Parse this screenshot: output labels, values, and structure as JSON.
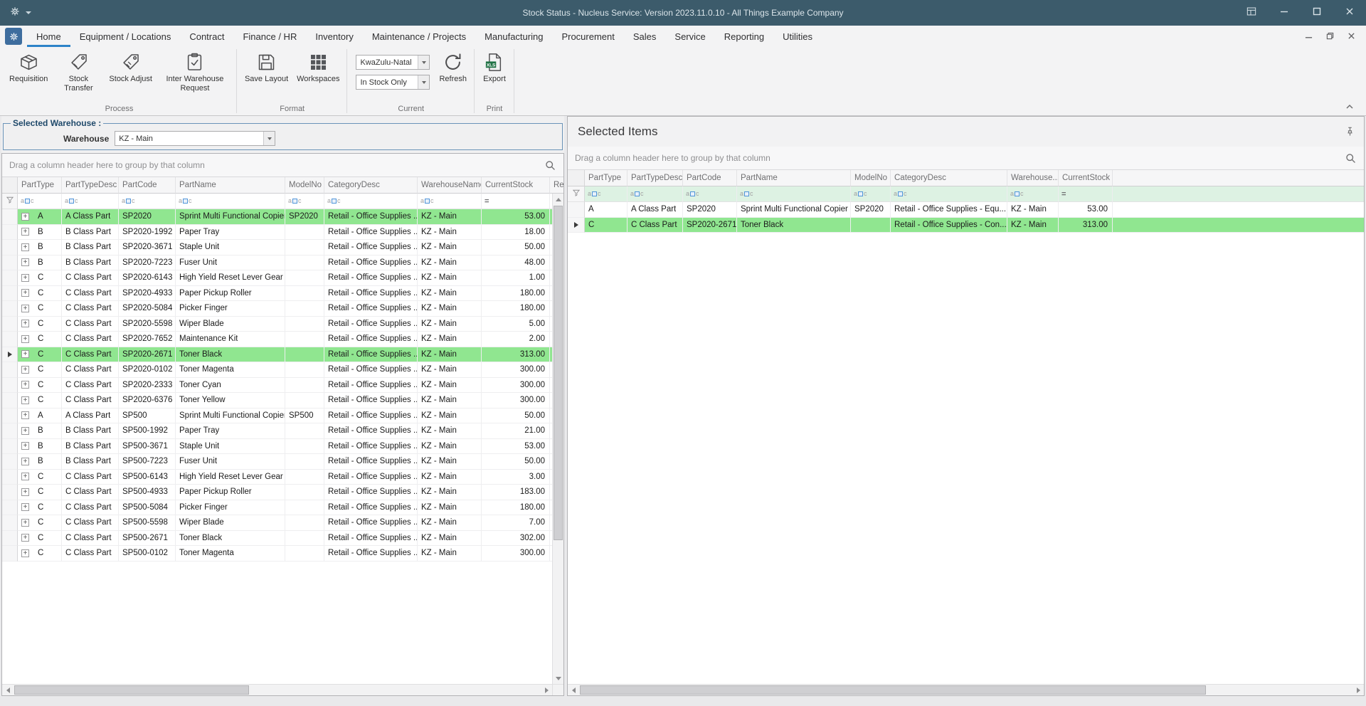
{
  "titlebar": {
    "title": "Stock Status - Nucleus Service: Version 2023.11.0.10 - All Things Example Company"
  },
  "ribbon": {
    "active_tab": "Home",
    "tabs": [
      "Home",
      "Equipment / Locations",
      "Contract",
      "Finance / HR",
      "Inventory",
      "Maintenance / Projects",
      "Manufacturing",
      "Procurement",
      "Sales",
      "Service",
      "Reporting",
      "Utilities"
    ],
    "groups": [
      {
        "label": "Process",
        "items": [
          {
            "type": "button",
            "label": "Requisition",
            "icon": "requisition-icon"
          },
          {
            "type": "button",
            "label": "Stock Transfer",
            "icon": "stock-transfer-icon"
          },
          {
            "type": "button",
            "label": "Stock Adjust",
            "icon": "stock-adjust-icon"
          },
          {
            "type": "button",
            "label": "Inter Warehouse Request",
            "icon": "inter-warehouse-request-icon"
          }
        ]
      },
      {
        "label": "Format",
        "items": [
          {
            "type": "button",
            "label": "Save Layout",
            "icon": "save-layout-icon"
          },
          {
            "type": "button",
            "label": "Workspaces",
            "icon": "workspaces-icon"
          }
        ]
      },
      {
        "label": "Current",
        "items": [
          {
            "type": "stack",
            "dropdowns": [
              {
                "name": "region-dropdown",
                "value": "KwaZulu-Natal"
              },
              {
                "name": "stock-filter-dropdown",
                "value": "In Stock Only"
              }
            ]
          },
          {
            "type": "button",
            "label": "Refresh",
            "icon": "refresh-icon"
          }
        ]
      },
      {
        "label": "Print",
        "items": [
          {
            "type": "button",
            "label": "Export",
            "icon": "export-xls-icon"
          }
        ]
      }
    ]
  },
  "selected_warehouse": {
    "legend": "Selected Warehouse :",
    "label": "Warehouse",
    "value": "KZ - Main"
  },
  "left_grid": {
    "group_panel_text": "Drag a column header here to group by that column",
    "columns": [
      "PartType",
      "PartTypeDesc",
      "PartCode",
      "PartName",
      "ModelNo",
      "CategoryDesc",
      "WarehouseName",
      "CurrentStock",
      "Res"
    ],
    "rows": [
      {
        "cells": [
          "A",
          "A Class Part",
          "SP2020",
          "Sprint Multi Functional Copier",
          "SP2020",
          "Retail - Office Supplies ...",
          "KZ - Main",
          "53.00"
        ],
        "highlight": true,
        "focused": false
      },
      {
        "cells": [
          "B",
          "B Class Part",
          "SP2020-1992",
          "Paper Tray",
          "",
          "Retail - Office Supplies ...",
          "KZ - Main",
          "18.00"
        ],
        "highlight": false,
        "focused": false
      },
      {
        "cells": [
          "B",
          "B Class Part",
          "SP2020-3671",
          "Staple Unit",
          "",
          "Retail - Office Supplies ...",
          "KZ - Main",
          "50.00"
        ],
        "highlight": false,
        "focused": false
      },
      {
        "cells": [
          "B",
          "B Class Part",
          "SP2020-7223",
          "Fuser Unit",
          "",
          "Retail - Office Supplies ...",
          "KZ - Main",
          "48.00"
        ],
        "highlight": false,
        "focused": false
      },
      {
        "cells": [
          "C",
          "C Class Part",
          "SP2020-6143",
          "High Yield Reset Lever Gear",
          "",
          "Retail - Office Supplies ...",
          "KZ - Main",
          "1.00"
        ],
        "highlight": false,
        "focused": false
      },
      {
        "cells": [
          "C",
          "C Class Part",
          "SP2020-4933",
          "Paper Pickup Roller",
          "",
          "Retail - Office Supplies ...",
          "KZ - Main",
          "180.00"
        ],
        "highlight": false,
        "focused": false
      },
      {
        "cells": [
          "C",
          "C Class Part",
          "SP2020-5084",
          "Picker Finger",
          "",
          "Retail - Office Supplies ...",
          "KZ - Main",
          "180.00"
        ],
        "highlight": false,
        "focused": false
      },
      {
        "cells": [
          "C",
          "C Class Part",
          "SP2020-5598",
          "Wiper Blade",
          "",
          "Retail - Office Supplies ...",
          "KZ - Main",
          "5.00"
        ],
        "highlight": false,
        "focused": false
      },
      {
        "cells": [
          "C",
          "C Class Part",
          "SP2020-7652",
          "Maintenance Kit",
          "",
          "Retail - Office Supplies ...",
          "KZ - Main",
          "2.00"
        ],
        "highlight": false,
        "focused": false
      },
      {
        "cells": [
          "C",
          "C Class Part",
          "SP2020-2671",
          "Toner Black",
          "",
          "Retail - Office Supplies ...",
          "KZ - Main",
          "313.00"
        ],
        "highlight": true,
        "focused": true
      },
      {
        "cells": [
          "C",
          "C Class Part",
          "SP2020-0102",
          "Toner Magenta",
          "",
          "Retail - Office Supplies ...",
          "KZ - Main",
          "300.00"
        ],
        "highlight": false,
        "focused": false
      },
      {
        "cells": [
          "C",
          "C Class Part",
          "SP2020-2333",
          "Toner Cyan",
          "",
          "Retail - Office Supplies ...",
          "KZ - Main",
          "300.00"
        ],
        "highlight": false,
        "focused": false
      },
      {
        "cells": [
          "C",
          "C Class Part",
          "SP2020-6376",
          "Toner Yellow",
          "",
          "Retail - Office Supplies ...",
          "KZ - Main",
          "300.00"
        ],
        "highlight": false,
        "focused": false
      },
      {
        "cells": [
          "A",
          "A Class Part",
          "SP500",
          "Sprint Multi Functional Copier",
          "SP500",
          "Retail - Office Supplies ...",
          "KZ - Main",
          "50.00"
        ],
        "highlight": false,
        "focused": false
      },
      {
        "cells": [
          "B",
          "B Class Part",
          "SP500-1992",
          "Paper Tray",
          "",
          "Retail - Office Supplies ...",
          "KZ - Main",
          "21.00"
        ],
        "highlight": false,
        "focused": false
      },
      {
        "cells": [
          "B",
          "B Class Part",
          "SP500-3671",
          "Staple Unit",
          "",
          "Retail - Office Supplies ...",
          "KZ - Main",
          "53.00"
        ],
        "highlight": false,
        "focused": false
      },
      {
        "cells": [
          "B",
          "B Class Part",
          "SP500-7223",
          "Fuser Unit",
          "",
          "Retail - Office Supplies ...",
          "KZ - Main",
          "50.00"
        ],
        "highlight": false,
        "focused": false
      },
      {
        "cells": [
          "C",
          "C Class Part",
          "SP500-6143",
          "High Yield Reset Lever Gear",
          "",
          "Retail - Office Supplies ...",
          "KZ - Main",
          "3.00"
        ],
        "highlight": false,
        "focused": false
      },
      {
        "cells": [
          "C",
          "C Class Part",
          "SP500-4933",
          "Paper Pickup Roller",
          "",
          "Retail - Office Supplies ...",
          "KZ - Main",
          "183.00"
        ],
        "highlight": false,
        "focused": false
      },
      {
        "cells": [
          "C",
          "C Class Part",
          "SP500-5084",
          "Picker Finger",
          "",
          "Retail - Office Supplies ...",
          "KZ - Main",
          "180.00"
        ],
        "highlight": false,
        "focused": false
      },
      {
        "cells": [
          "C",
          "C Class Part",
          "SP500-5598",
          "Wiper Blade",
          "",
          "Retail - Office Supplies ...",
          "KZ - Main",
          "7.00"
        ],
        "highlight": false,
        "focused": false
      },
      {
        "cells": [
          "C",
          "C Class Part",
          "SP500-2671",
          "Toner Black",
          "",
          "Retail - Office Supplies ...",
          "KZ - Main",
          "302.00"
        ],
        "highlight": false,
        "focused": false
      },
      {
        "cells": [
          "C",
          "C Class Part",
          "SP500-0102",
          "Toner Magenta",
          "",
          "Retail - Office Supplies ...",
          "KZ - Main",
          "300.00"
        ],
        "highlight": false,
        "focused": false
      }
    ]
  },
  "selected_items": {
    "title": "Selected Items",
    "group_panel_text": "Drag a column header here to group by that column",
    "columns": [
      "PartType",
      "PartTypeDesc",
      "PartCode",
      "PartName",
      "ModelNo",
      "CategoryDesc",
      "Warehouse...",
      "CurrentStock"
    ],
    "rows": [
      {
        "cells": [
          "A",
          "A Class Part",
          "SP2020",
          "Sprint Multi Functional Copier",
          "SP2020",
          "Retail - Office Supplies - Equ...",
          "KZ - Main",
          "53.00"
        ],
        "highlight": false,
        "focused": false
      },
      {
        "cells": [
          "C",
          "C Class Part",
          "SP2020-2671",
          "Toner Black",
          "",
          "Retail - Office Supplies - Con...",
          "KZ - Main",
          "313.00"
        ],
        "highlight": true,
        "focused": true
      }
    ]
  },
  "grid_glyphs": {
    "abc_prefix": "a",
    "abc_suffix": "c",
    "equals": "=",
    "expand": "+"
  },
  "colors": {
    "titlebar": "#3c5b6b",
    "accent_blue": "#2d83c8",
    "highlight_green": "#90e690",
    "filter_mint": "#ddf2e3"
  }
}
